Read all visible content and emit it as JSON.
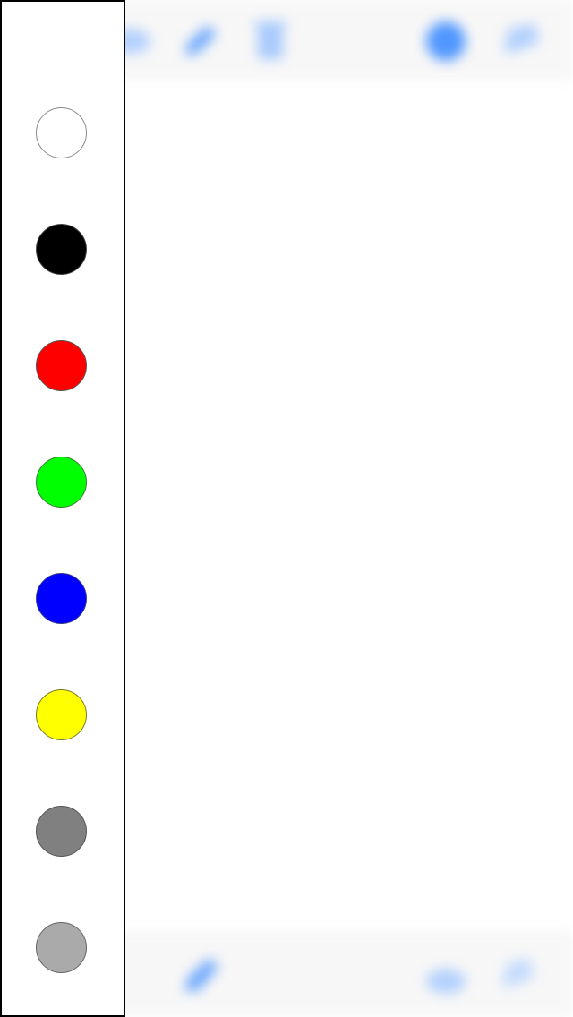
{
  "palette": {
    "colors": [
      {
        "name": "white",
        "hex": "#FFFFFF",
        "border": "#8a8a8a"
      },
      {
        "name": "black",
        "hex": "#000000",
        "border": "#444444"
      },
      {
        "name": "red",
        "hex": "#FF0000",
        "border": "#555555"
      },
      {
        "name": "green",
        "hex": "#00FF00",
        "border": "#3a7a3a"
      },
      {
        "name": "blue",
        "hex": "#0000FF",
        "border": "#3a3a8a"
      },
      {
        "name": "yellow",
        "hex": "#FFFF00",
        "border": "#7a7a2a"
      },
      {
        "name": "gray",
        "hex": "#808080",
        "border": "#555555"
      },
      {
        "name": "light-gray",
        "hex": "#AAAAAA",
        "border": "#666666"
      }
    ]
  },
  "toolbar_top": {
    "icons": [
      "menu-icon",
      "undo-icon",
      "pen-icon",
      "trash-icon",
      "color-dot-icon",
      "share-icon"
    ]
  },
  "toolbar_bottom": {
    "icons": [
      "pen-icon",
      "layers-icon",
      "share-icon"
    ]
  },
  "colors": {
    "accent": "#4a9cff",
    "toolbar_bg": "#f7f7f7",
    "border": "#000000"
  }
}
